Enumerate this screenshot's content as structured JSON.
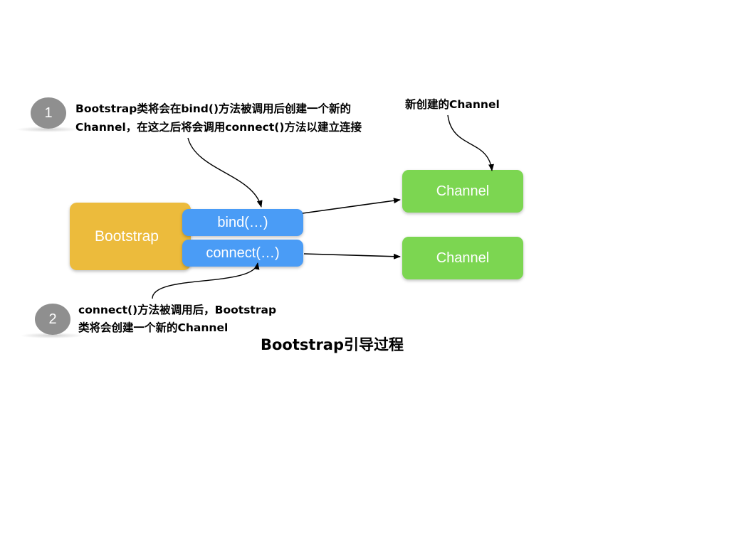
{
  "steps": [
    {
      "number": "1",
      "lines": [
        "Bootstrap类将会在bind()方法被调用后创建一个新的",
        "Channel，在这之后将会调用connect()方法以建立连接"
      ]
    },
    {
      "number": "2",
      "lines": [
        "connect()方法被调用后，Bootstrap",
        "类将会创建一个新的Channel"
      ]
    }
  ],
  "new_channel_note": "新创建的Channel",
  "bootstrap_box": {
    "label": "Bootstrap",
    "color": "#ecbb3c"
  },
  "methods": [
    {
      "label": "bind(…)",
      "color": "#4a9cf6"
    },
    {
      "label": "connect(…)",
      "color": "#4a9cf6"
    }
  ],
  "channels": [
    {
      "label": "Channel",
      "color": "#7cd651"
    },
    {
      "label": "Channel",
      "color": "#7cd651"
    }
  ],
  "caption": "Bootstrap引导过程"
}
